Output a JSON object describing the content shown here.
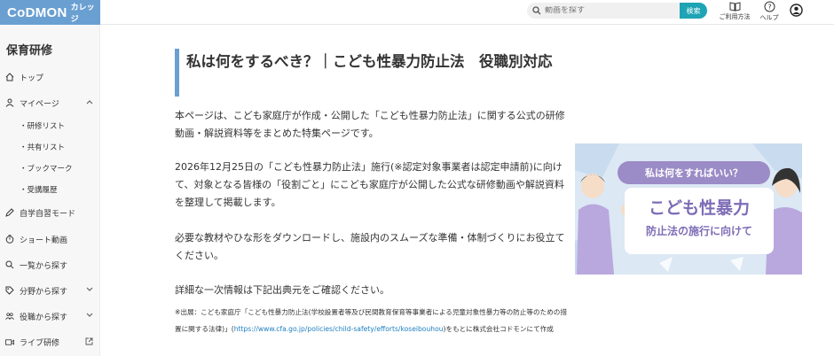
{
  "header": {
    "logo_main": "CoDMON",
    "logo_sub": "カレッジ",
    "search_placeholder": "動画を探す",
    "search_button": "検索",
    "usage_label": "ご利用方法",
    "help_label": "ヘルプ"
  },
  "sidebar": {
    "title": "保育研修",
    "items": {
      "top": "トップ",
      "mypage": "マイページ",
      "training_list": "・研修リスト",
      "shared_list": "・共有リスト",
      "bookmark": "・ブックマーク",
      "history": "・受講履歴",
      "self_study": "自学自習モード",
      "short_video": "ショート動画",
      "list_search": "一覧から探す",
      "field_search": "分野から探す",
      "role_search": "役職から探す",
      "live": "ライブ研修"
    }
  },
  "main": {
    "title": "私は何をするべき？｜こども性暴力防止法　役職別対応",
    "para1": "本ページは、こども家庭庁が作成・公開した「こども性暴力防止法」に関する公式の研修動画・解説資料等をまとめた特集ページです。",
    "para2": "2026年12月25日の「こども性暴力防止法」施行(※認定対象事業者は認定申請前)に向けて、対象となる皆様の「役割ごと」にこども家庭庁が公開した公式な研修動画や解説資料を整理して掲載します。",
    "para3": "必要な教材やひな形をダウンロードし、施設内のスムーズな準備・体制づくりにお役立てください。",
    "para4": "詳細な一次情報は下記出典元をご確認ください。",
    "note_prefix": "※出展：こども家庭庁「こども性暴力防止法(学校設置者等及び民間教育保育等事業者による児童対象性暴力等の防止等のための措置に関する法律)」(",
    "note_link": "https://www.cfa.go.jp/policies/child-safety/efforts/koseibouhou",
    "note_suffix": ")をもとに株式会社コドモンにて作成"
  },
  "banner": {
    "speech": "私は何をすればいい？",
    "line1": "こども性暴力",
    "line2": "防止法の施行に向けて"
  },
  "colors": {
    "logo_bg": "#6a9fd1",
    "search_btn": "#1ea4b4",
    "link": "#1e7fc0",
    "banner_purple": "#7d6cb6"
  }
}
